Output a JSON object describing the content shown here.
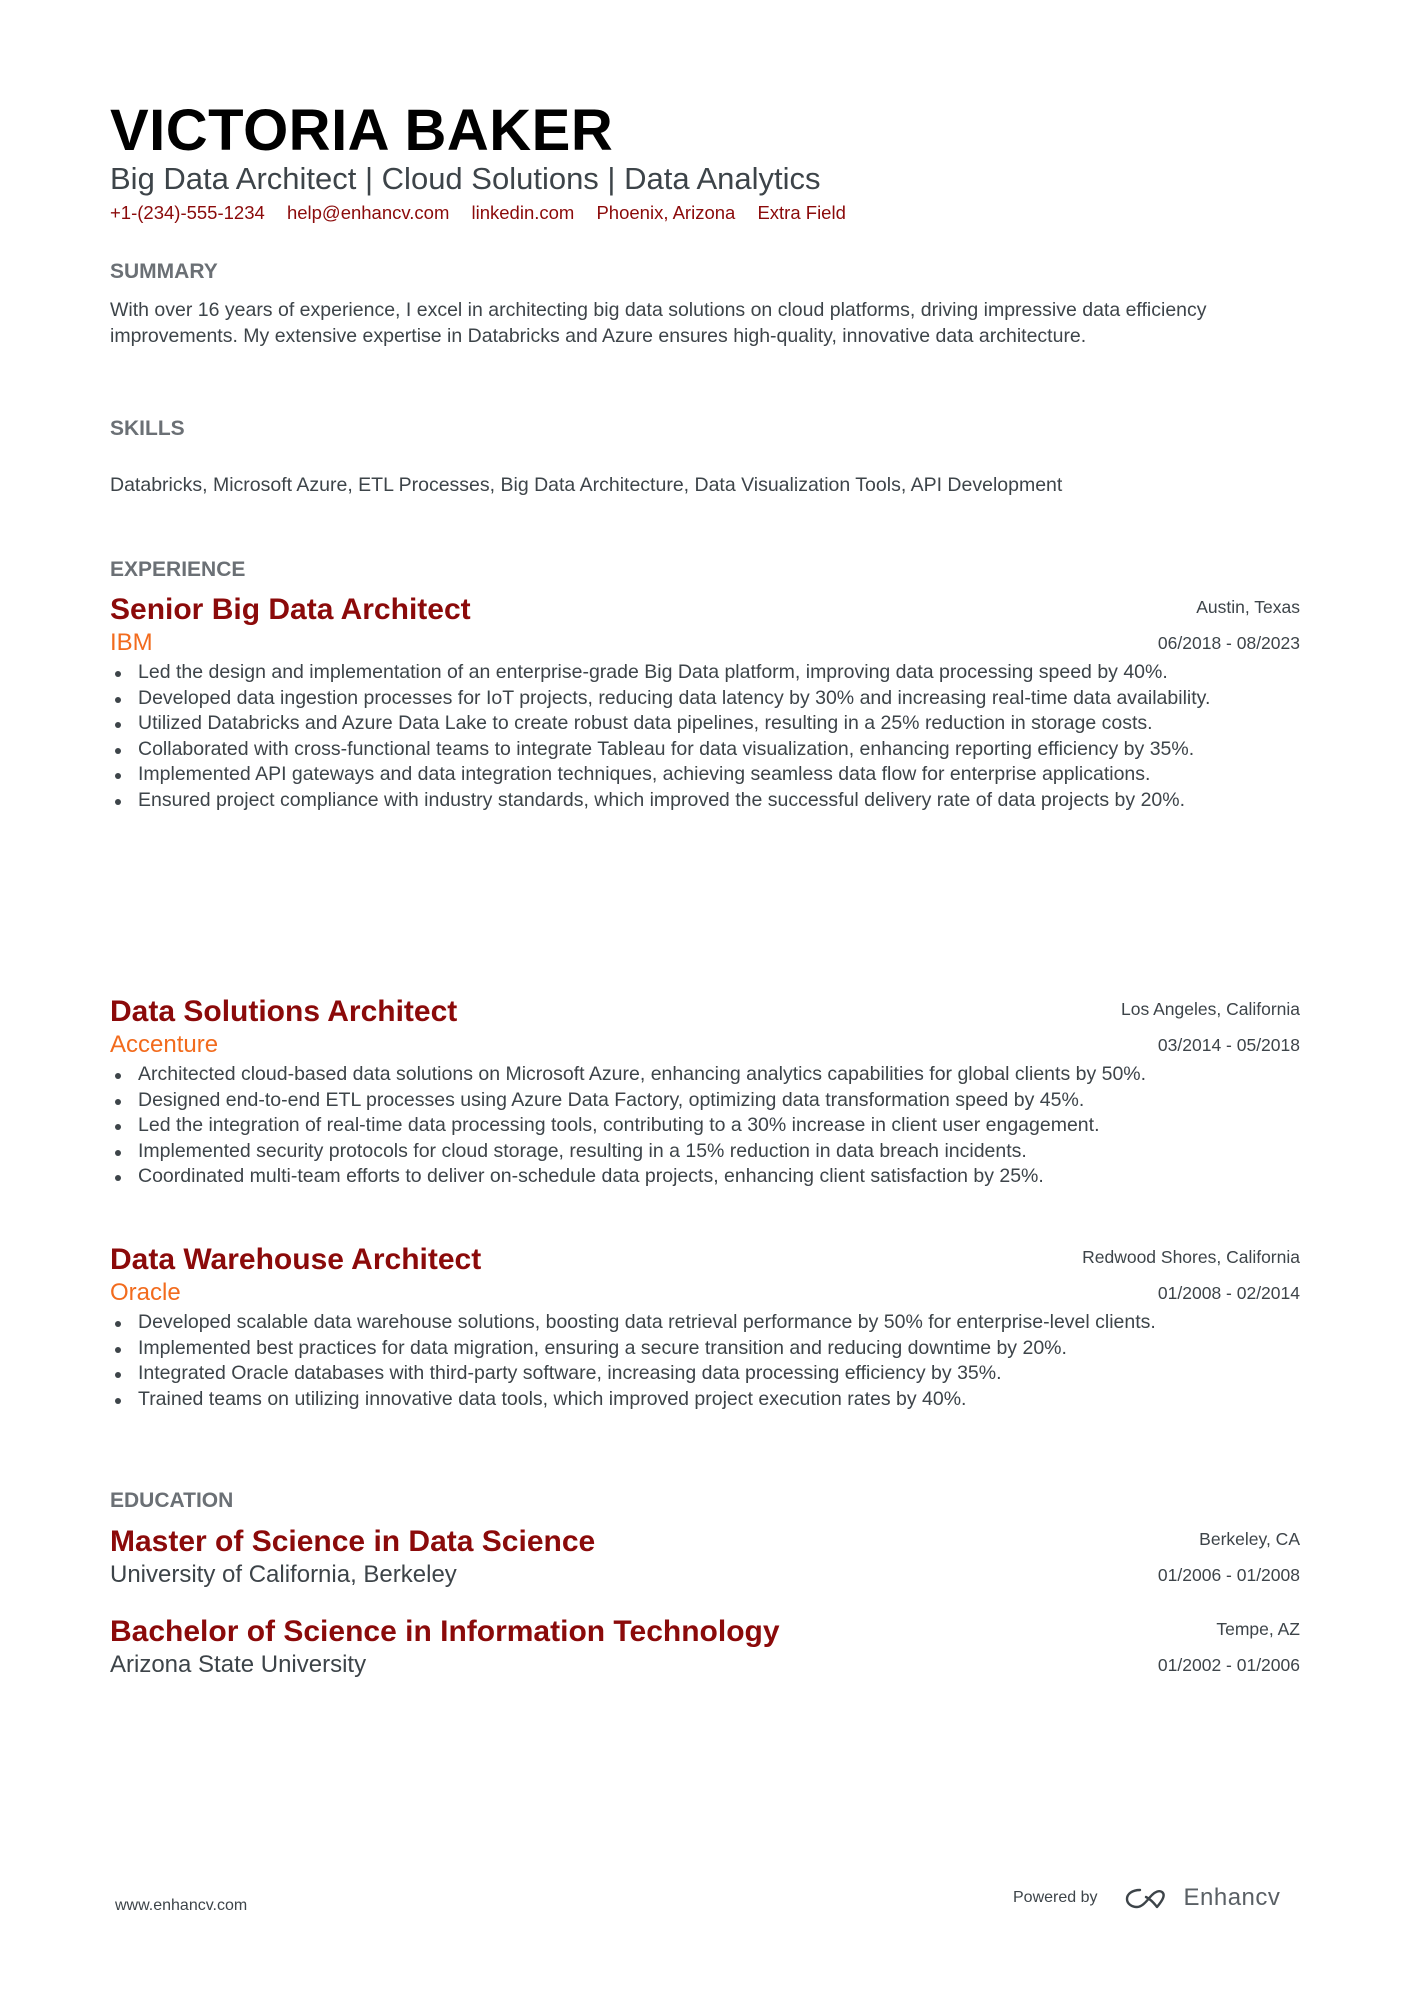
{
  "header": {
    "name": "VICTORIA BAKER",
    "headline": "Big Data Architect | Cloud Solutions | Data Analytics",
    "contacts": [
      "+1-(234)-555-1234",
      "help@enhancv.com",
      "linkedin.com",
      "Phoenix, Arizona",
      "Extra Field"
    ]
  },
  "summary": {
    "heading": "SUMMARY",
    "text": "With over 16 years of experience, I excel in architecting big data solutions on cloud platforms, driving impressive data efficiency improvements. My extensive expertise in Databricks and Azure ensures high-quality, innovative data architecture."
  },
  "skills": {
    "heading": "SKILLS",
    "text": "Databricks, Microsoft Azure, ETL Processes, Big Data Architecture, Data Visualization Tools, API Development"
  },
  "experience": {
    "heading": "EXPERIENCE",
    "items": [
      {
        "title": "Senior Big Data Architect",
        "company": "IBM",
        "location": "Austin, Texas",
        "dates": "06/2018 - 08/2023",
        "bullets": [
          "Led the design and implementation of an enterprise-grade Big Data platform, improving data processing speed by 40%.",
          "Developed data ingestion processes for IoT projects, reducing data latency by 30% and increasing real-time data availability.",
          "Utilized Databricks and Azure Data Lake to create robust data pipelines, resulting in a 25% reduction in storage costs.",
          "Collaborated with cross-functional teams to integrate Tableau for data visualization, enhancing reporting efficiency by 35%.",
          "Implemented API gateways and data integration techniques, achieving seamless data flow for enterprise applications.",
          "Ensured project compliance with industry standards, which improved the successful delivery rate of data projects by 20%."
        ]
      },
      {
        "title": "Data Solutions Architect",
        "company": "Accenture",
        "location": "Los Angeles, California",
        "dates": "03/2014 - 05/2018",
        "bullets": [
          "Architected cloud-based data solutions on Microsoft Azure, enhancing analytics capabilities for global clients by 50%.",
          "Designed end-to-end ETL processes using Azure Data Factory, optimizing data transformation speed by 45%.",
          "Led the integration of real-time data processing tools, contributing to a 30% increase in client user engagement.",
          "Implemented security protocols for cloud storage, resulting in a 15% reduction in data breach incidents.",
          "Coordinated multi-team efforts to deliver on-schedule data projects, enhancing client satisfaction by 25%."
        ]
      },
      {
        "title": "Data Warehouse Architect",
        "company": "Oracle",
        "location": "Redwood Shores, California",
        "dates": "01/2008 - 02/2014",
        "bullets": [
          "Developed scalable data warehouse solutions, boosting data retrieval performance by 50% for enterprise-level clients.",
          "Implemented best practices for data migration, ensuring a secure transition and reducing downtime by 20%.",
          "Integrated Oracle databases with third-party software, increasing data processing efficiency by 35%.",
          "Trained teams on utilizing innovative data tools, which improved project execution rates by 40%."
        ]
      }
    ]
  },
  "education": {
    "heading": "EDUCATION",
    "items": [
      {
        "degree": "Master of Science in Data Science",
        "school": "University of California, Berkeley",
        "location": "Berkeley, CA",
        "dates": "01/2006 - 01/2008"
      },
      {
        "degree": "Bachelor of Science in Information Technology",
        "school": "Arizona State University",
        "location": "Tempe, AZ",
        "dates": "01/2002 - 01/2006"
      }
    ]
  },
  "footer": {
    "website": "www.enhancv.com",
    "powered_by": "Powered by",
    "brand": "Enhancv",
    "brand_icon": "enhancv-logo-icon"
  },
  "colors": {
    "name": "#000000",
    "accent_title": "#8b0a0a",
    "accent_company": "#f26b1d",
    "section_heading": "#6b7075",
    "body_text": "#3d4449"
  }
}
